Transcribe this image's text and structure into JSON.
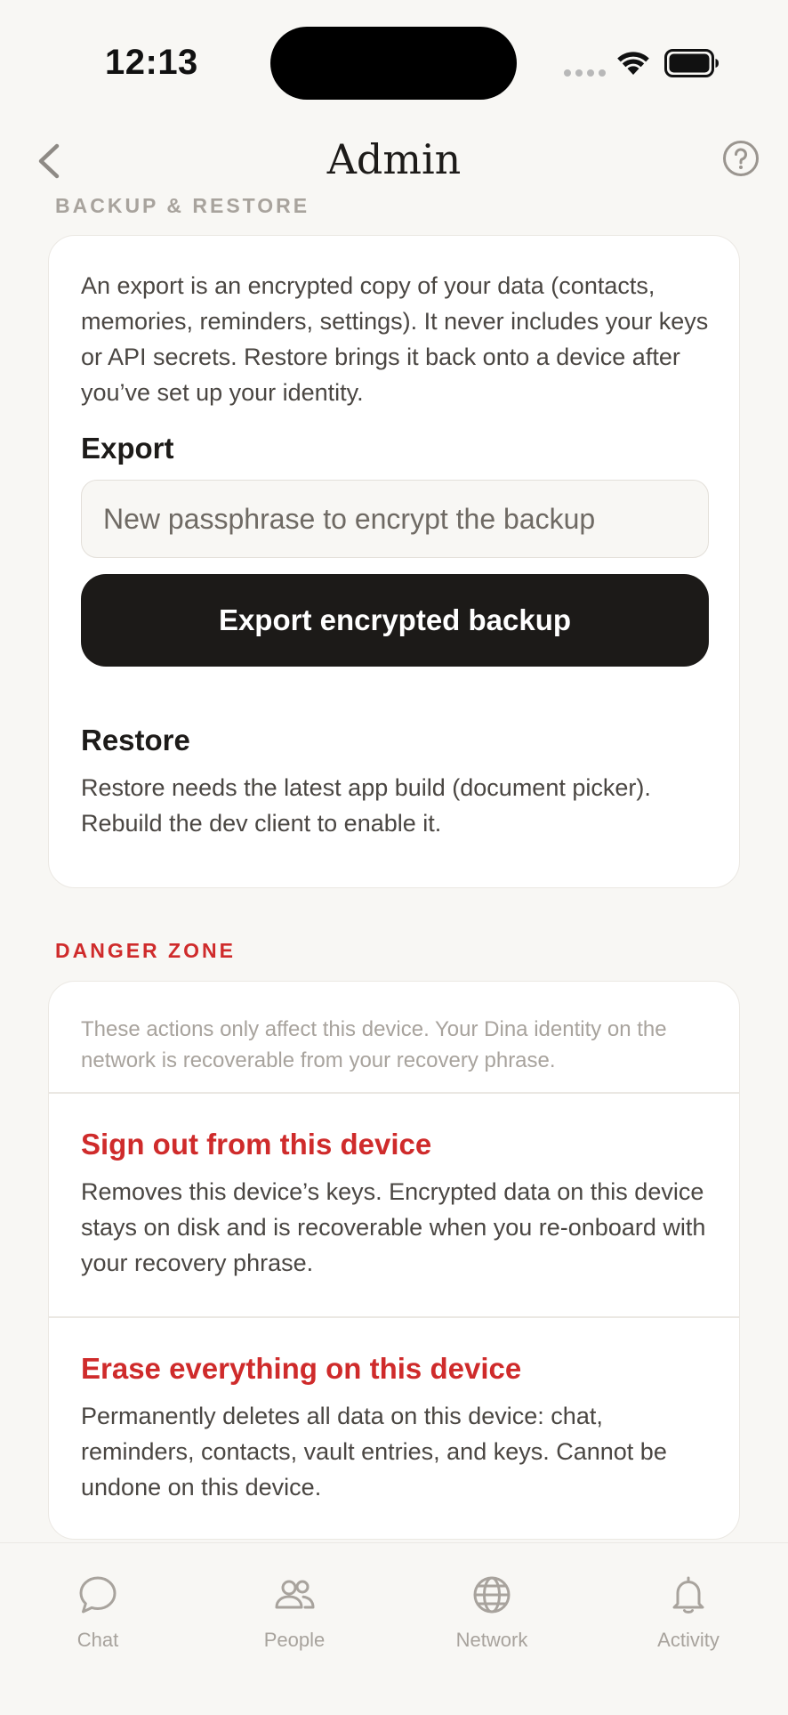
{
  "status_bar": {
    "time": "12:13"
  },
  "header": {
    "title": "Admin"
  },
  "backup": {
    "section_title": "BACKUP & RESTORE",
    "description": "An export is an encrypted copy of your data (contacts, memories, reminders, settings). It never includes your keys or API secrets. Restore brings it back onto a device after you’ve set up your identity.",
    "export_heading": "Export",
    "passphrase_placeholder": "New passphrase to encrypt the backup",
    "passphrase_value": "",
    "export_button": "Export encrypted backup",
    "restore_heading": "Restore",
    "restore_description": "Restore needs the latest app build (document picker). Rebuild the dev client to enable it."
  },
  "danger": {
    "section_title": "DANGER ZONE",
    "note": "These actions only affect this device. Your Dina identity on the network is recoverable from your recovery phrase.",
    "actions": [
      {
        "title": "Sign out from this device",
        "description": "Removes this device’s keys. Encrypted data on this device stays on disk and is recoverable when you re-onboard with your recovery phrase."
      },
      {
        "title": "Erase everything on this device",
        "description": "Permanently deletes all data on this device: chat, reminders, contacts, vault entries, and keys. Cannot be undone on this device."
      }
    ]
  },
  "tabs": [
    {
      "label": "Chat",
      "icon": "chat-bubble-icon"
    },
    {
      "label": "People",
      "icon": "people-icon"
    },
    {
      "label": "Network",
      "icon": "globe-icon"
    },
    {
      "label": "Activity",
      "icon": "bell-icon"
    }
  ],
  "colors": {
    "background": "#f8f7f4",
    "danger": "#cf2b2b",
    "primary_button": "#1c1a18",
    "muted": "#a8a39d"
  }
}
